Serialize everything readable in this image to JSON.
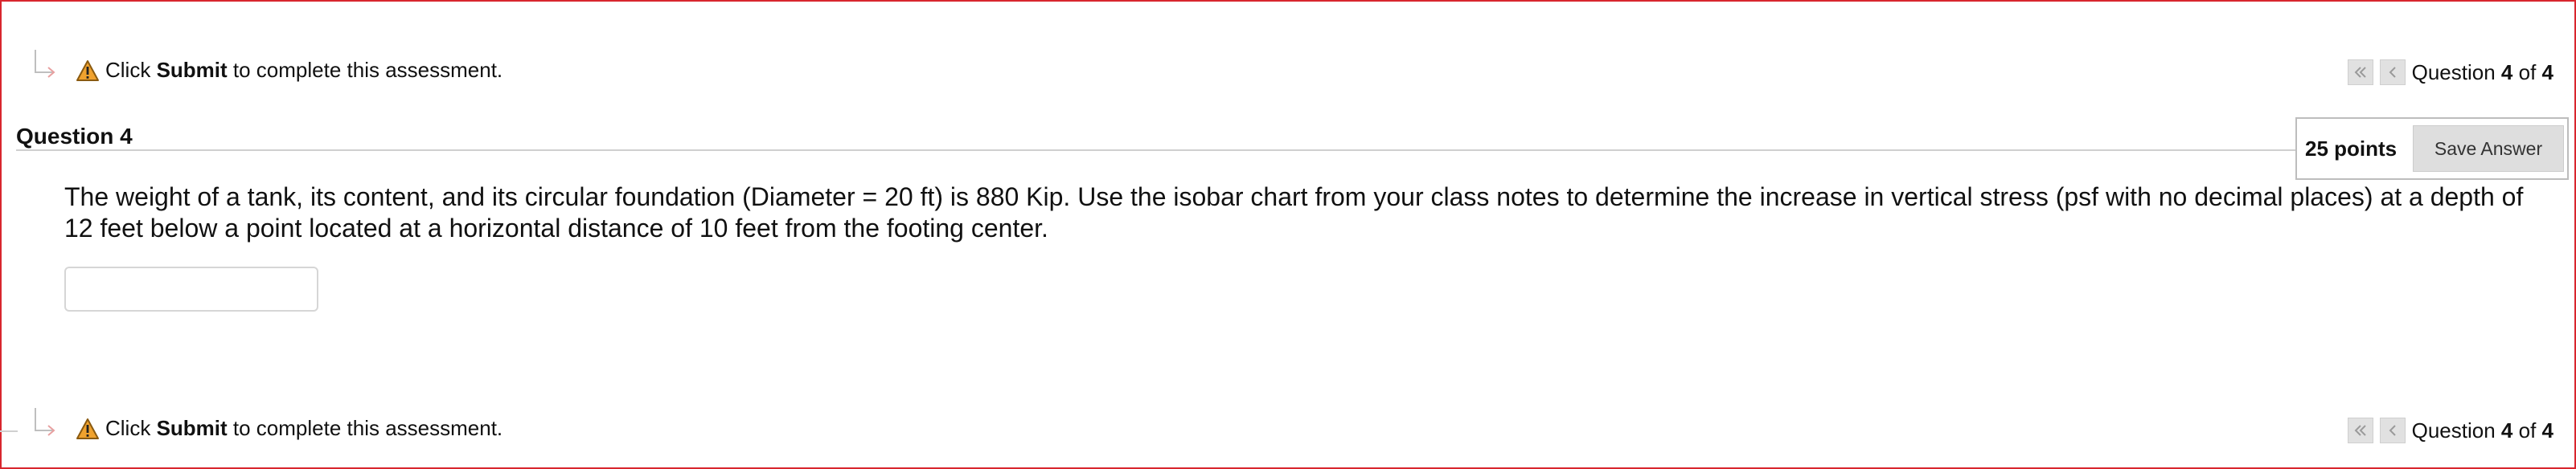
{
  "instruction": {
    "prefix": "Click ",
    "keyword": "Submit",
    "suffix": " to complete this assessment."
  },
  "navigation": {
    "label_prefix": "Question ",
    "current": "4",
    "of_text": " of ",
    "total": "4"
  },
  "question": {
    "title": "Question 4",
    "points": "25 points",
    "save_label": "Save Answer",
    "text": "The weight of a tank, its content, and its circular foundation (Diameter = 20 ft) is 880 Kip.  Use the isobar chart from your class notes to determine the increase in vertical stress (psf with no decimal places) at a depth of 12 feet below a point located at a horizontal distance of 10 feet from the footing center.",
    "answer_value": ""
  },
  "icons": {
    "warning": "warning-triangle-icon",
    "arrow": "return-arrow-icon",
    "first": "double-chevron-left-icon",
    "prev": "chevron-left-icon"
  },
  "colors": {
    "frame": "#d8262e",
    "warning_fill": "#f0a22e",
    "button_bg": "#dedede"
  }
}
